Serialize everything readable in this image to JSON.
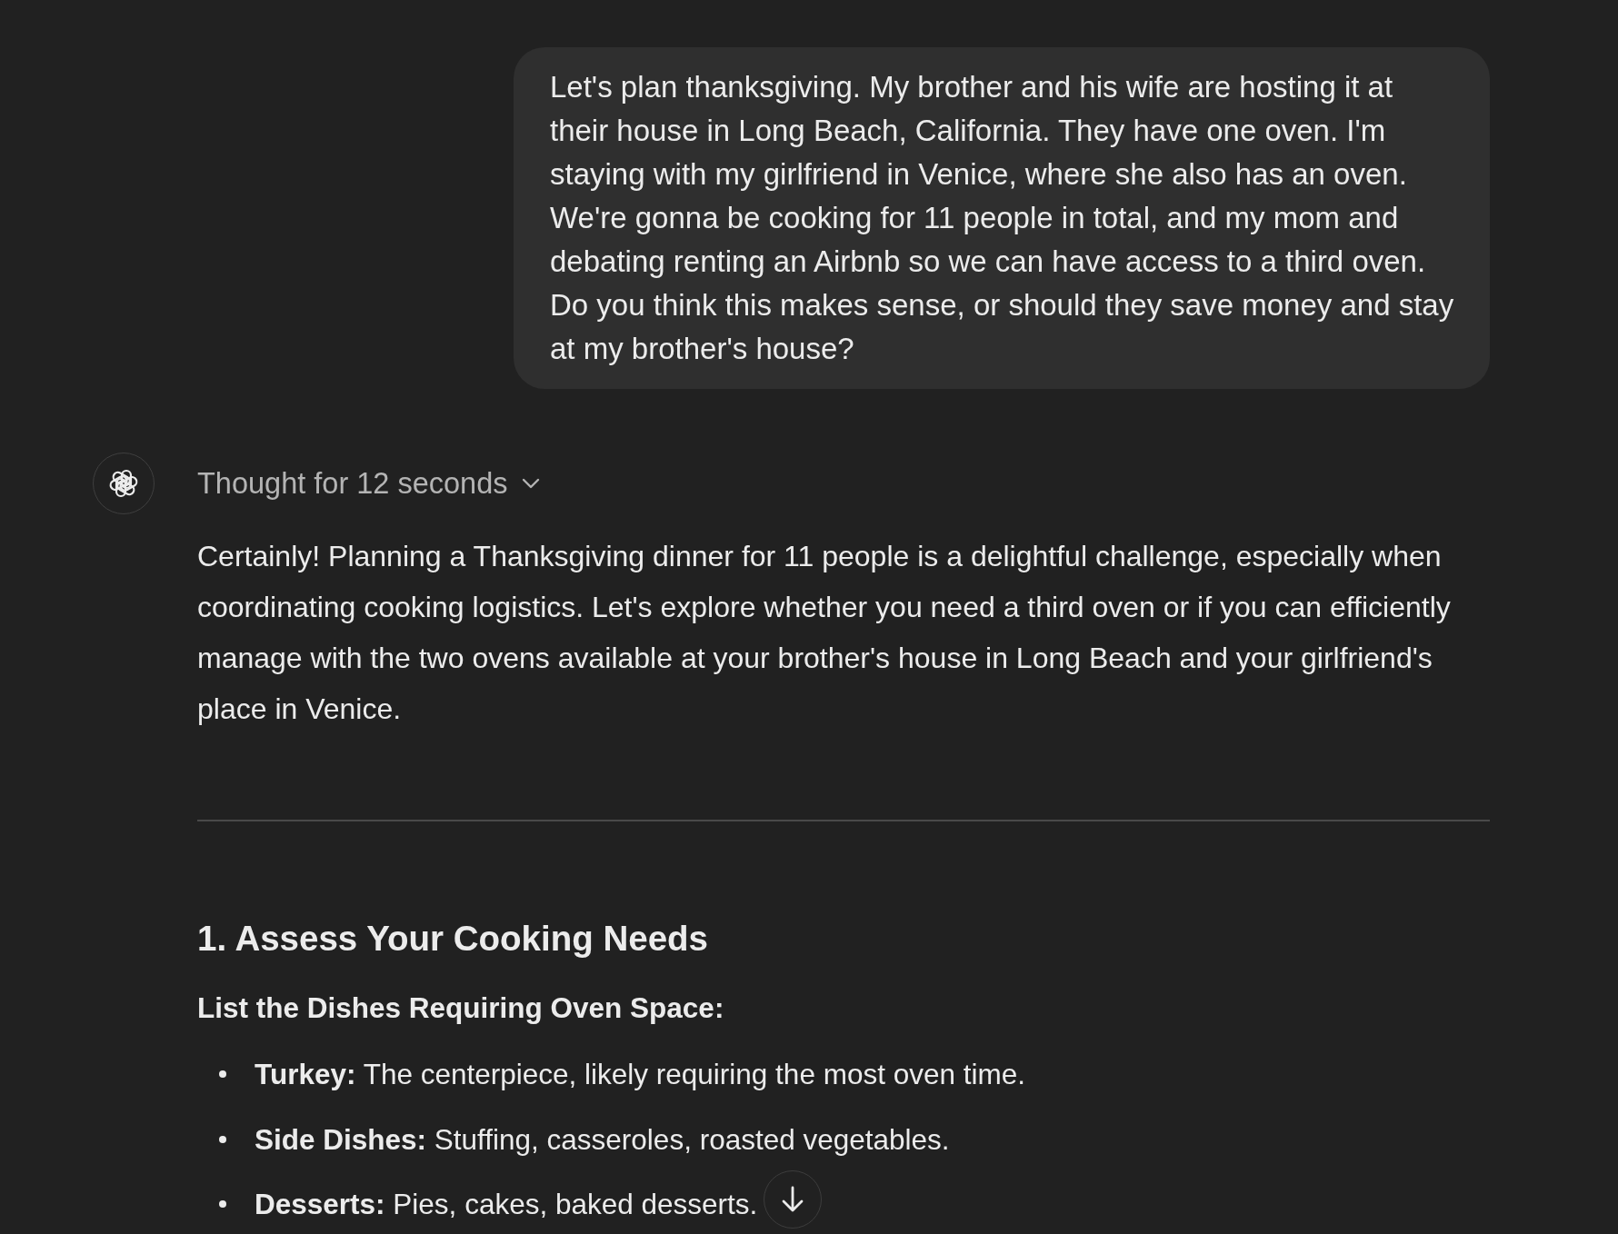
{
  "user_message": {
    "text": "Let's plan thanksgiving. My brother and his wife are hosting it at their house in Long Beach, California. They have one oven. I'm staying with my girlfriend in Venice, where she also has an oven. We're gonna be cooking for 11 people in total, and my mom and debating renting an Airbnb so we can have access to a third oven. Do you think this makes sense, or should they save money and stay at my brother's house?"
  },
  "assistant_message": {
    "thought": {
      "label": "Thought for 12 seconds",
      "expanded": false
    },
    "intro": "Certainly! Planning a Thanksgiving dinner for 11 people is a delightful challenge, especially when coordinating cooking logistics. Let's explore whether you need a third oven or if you can efficiently manage with the two ovens available at your brother's house in Long Beach and your girlfriend's place in Venice.",
    "sections": [
      {
        "heading": "1. Assess Your Cooking Needs",
        "subheading": "List the Dishes Requiring Oven Space:",
        "items": [
          "**Turkey:** The centerpiece, likely requiring the most oven time.",
          "**Side Dishes:** Stuffing, casseroles, roasted vegetables.",
          "**Desserts:** Pies, cakes, baked desserts."
        ]
      }
    ]
  }
}
